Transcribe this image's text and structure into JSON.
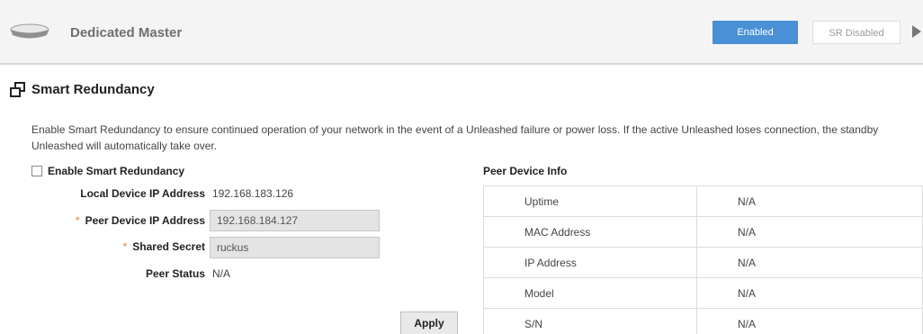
{
  "header": {
    "device_icon": "access-point-icon",
    "title": "Dedicated Master",
    "enabled_label": "Enabled",
    "sr_disabled_label": "SR Disabled",
    "expand_icon": "triangle-right-icon",
    "accent_color": "#4a90d6"
  },
  "section": {
    "icon": "redundancy-icon",
    "title": "Smart Redundancy",
    "description": "Enable Smart Redundancy to ensure continued operation of your network in the event of a Unleashed failure or power loss. If the active Unleashed loses connection, the standby Unleashed will automatically take over."
  },
  "form": {
    "enable_label": "Enable Smart Redundancy",
    "enable_checked": false,
    "local_ip_label": "Local Device IP Address",
    "local_ip_value": "192.168.183.126",
    "peer_ip_label": "Peer Device IP Address",
    "peer_ip_value": "192.168.184.127",
    "shared_secret_label": "Shared Secret",
    "shared_secret_value": "ruckus",
    "peer_status_label": "Peer Status",
    "peer_status_value": "N/A",
    "required_mark": "*",
    "required_color": "#e07b2e",
    "apply_label": "Apply"
  },
  "peer_info": {
    "title": "Peer Device Info",
    "rows": [
      {
        "key": "Uptime",
        "value": "N/A"
      },
      {
        "key": "MAC Address",
        "value": "N/A"
      },
      {
        "key": "IP Address",
        "value": "N/A"
      },
      {
        "key": "Model",
        "value": "N/A"
      },
      {
        "key": "S/N",
        "value": "N/A"
      }
    ]
  }
}
